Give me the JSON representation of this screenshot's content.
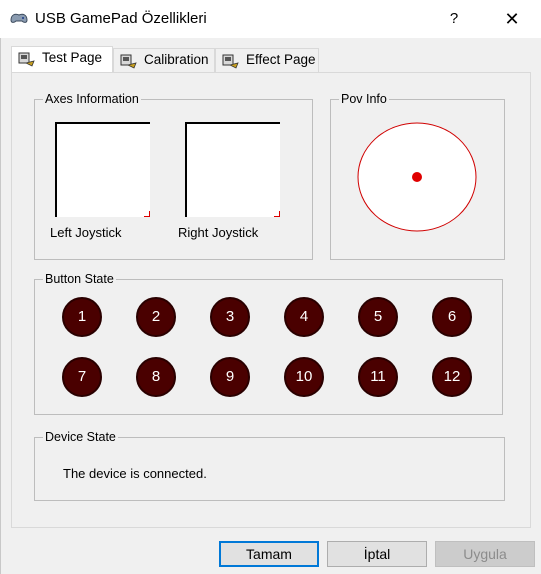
{
  "window": {
    "title": "USB GamePad Özellikleri",
    "help_label": "?",
    "close_label": "✕"
  },
  "tabs": [
    {
      "label": "Test Page",
      "active": true,
      "icon": "gamepad-icon"
    },
    {
      "label": "Calibration",
      "active": false,
      "icon": "gamepad-icon"
    },
    {
      "label": "Effect Page",
      "active": false,
      "icon": "gamepad-icon"
    }
  ],
  "axes": {
    "title": "Axes Information",
    "left_label": "Left Joystick",
    "right_label": "Right Joystick"
  },
  "pov": {
    "title": "Pov Info"
  },
  "buttons": {
    "title": "Button State",
    "items": [
      "1",
      "2",
      "3",
      "4",
      "5",
      "6",
      "7",
      "8",
      "9",
      "10",
      "11",
      "12"
    ],
    "color": "#4a0000"
  },
  "device": {
    "title": "Device State",
    "status": "The device is connected."
  },
  "dialog_buttons": {
    "ok": "Tamam",
    "cancel": "İptal",
    "apply": "Uygula"
  },
  "colors": {
    "accent": "#0078d7",
    "indicator": "#e00000"
  }
}
